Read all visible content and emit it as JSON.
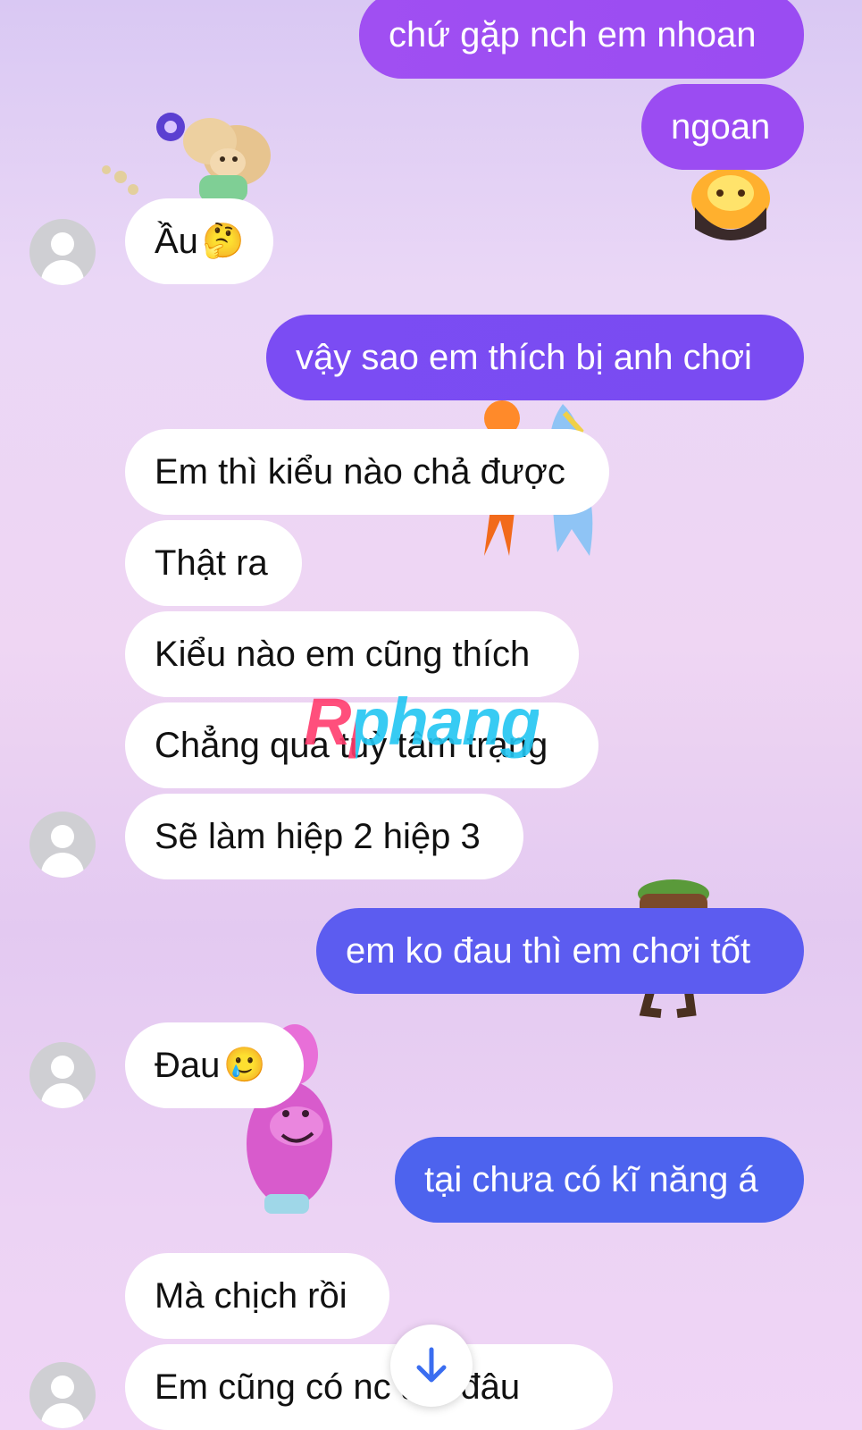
{
  "colors": {
    "outgoing_purple": "#9b4cf2",
    "outgoing_violet": "#6a4bf3",
    "outgoing_indigo": "#5b5bf0",
    "outgoing_blue": "#4d63ee",
    "incoming_bg": "#ffffff",
    "avatar_gray": "#cfcfd3",
    "scroll_arrow": "#3a6df0"
  },
  "messages": [
    {
      "direction": "outgoing",
      "text": "chứ gặp nch em nhoan"
    },
    {
      "direction": "outgoing",
      "text": "ngoan"
    },
    {
      "direction": "incoming",
      "text": "Ầu",
      "emoji": "🤔"
    },
    {
      "direction": "outgoing",
      "text": "vậy sao em thích bị anh chơi"
    },
    {
      "direction": "incoming",
      "text": "Em thì kiểu nào chả được"
    },
    {
      "direction": "incoming",
      "text": "Thật ra"
    },
    {
      "direction": "incoming",
      "text": "Kiểu nào em cũng thích"
    },
    {
      "direction": "incoming",
      "text": "Chẳng qua tuỳ tâm trạng"
    },
    {
      "direction": "incoming",
      "text": "Sẽ làm hiệp 2 hiệp 3"
    },
    {
      "direction": "outgoing",
      "text": "em ko đau thì em chơi tốt"
    },
    {
      "direction": "incoming",
      "text": "Đau",
      "emoji": "🥲"
    },
    {
      "direction": "outgoing",
      "text": "tại chưa có kĩ năng á"
    },
    {
      "direction": "incoming",
      "text": "Mà chịch rồi"
    },
    {
      "direction": "incoming",
      "text": "Em cũng có nc  am đâu"
    }
  ],
  "watermark": {
    "text": "Rphang"
  },
  "scroll_button": {
    "icon": "arrow-down-icon"
  },
  "stickers": [
    "cloud-character-sticker",
    "fire-character-sticker",
    "fire-water-couple-sticker",
    "earth-character-sticker",
    "pink-cloud-character-sticker"
  ]
}
